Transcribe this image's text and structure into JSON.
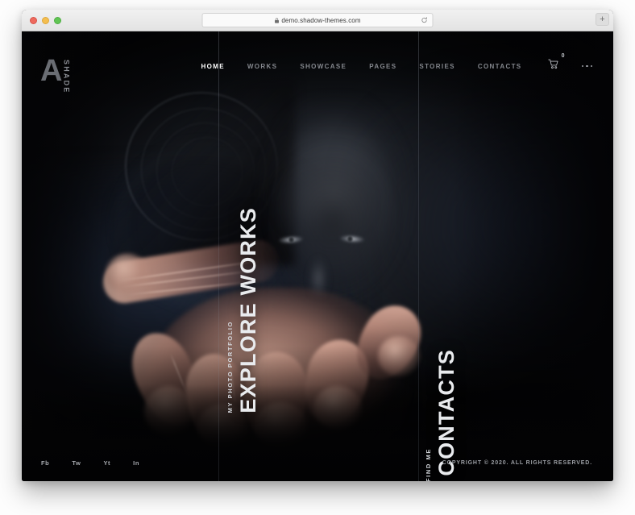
{
  "browser": {
    "url": "demo.shadow-themes.com",
    "lock_icon": "lock-icon",
    "reload_icon": "reload-icon",
    "new_tab_label": "+",
    "traffic_lights": [
      "close",
      "minimize",
      "zoom"
    ]
  },
  "site": {
    "logo": {
      "mark": "A",
      "wordmark": "SHADE"
    },
    "nav": {
      "items": [
        {
          "label": "HOME",
          "active": true
        },
        {
          "label": "WORKS",
          "active": false
        },
        {
          "label": "SHOWCASE",
          "active": false
        },
        {
          "label": "PAGES",
          "active": false
        },
        {
          "label": "STORIES",
          "active": false
        },
        {
          "label": "CONTACTS",
          "active": false
        }
      ],
      "cart": {
        "icon": "shopping-cart-icon",
        "count": "0"
      },
      "more_menu_icon": "ellipsis-icon"
    },
    "cta": {
      "works": {
        "subtitle": "MY PHOTO PORTFOLIO",
        "title": "EXPLORE WORKS"
      },
      "contacts": {
        "subtitle": "HOW TO FIND ME",
        "title": "MY CONTACTS"
      }
    },
    "footer": {
      "socials": [
        {
          "label": "Fb"
        },
        {
          "label": "Tw"
        },
        {
          "label": "Yt"
        },
        {
          "label": "In"
        }
      ],
      "copyright": "COPYRIGHT © 2020. ALL RIGHTS RESERVED."
    },
    "colors": {
      "page_background": "#070709",
      "nav_inactive": "#84878d",
      "nav_active": "#ffffff",
      "heading": "#e9ebee",
      "divider": "rgba(170,178,192,0.24)"
    }
  }
}
